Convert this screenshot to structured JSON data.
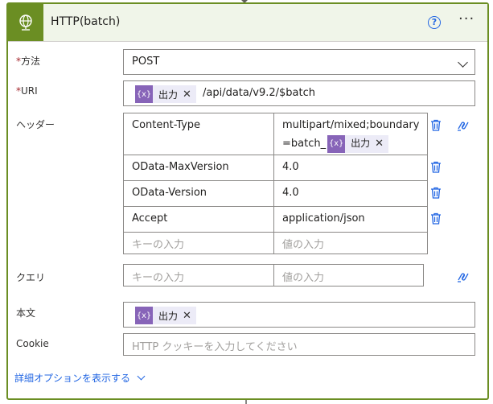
{
  "header": {
    "title": "HTTP(batch)",
    "help": "?",
    "more": "···"
  },
  "method": {
    "label": "方法",
    "required_mark": "*",
    "value": "POST"
  },
  "uri": {
    "label": "URI",
    "required_mark": "*",
    "token": {
      "icon": "{x}",
      "label": "出力"
    },
    "suffix": "/api/data/v9.2/$batch"
  },
  "headers": {
    "label": "ヘッダー",
    "rows": [
      {
        "key": "Content-Type",
        "value_line1": "multipart/mixed;boundary",
        "value_prefix": "=batch_",
        "token": {
          "icon": "{x}",
          "label": "出力"
        }
      },
      {
        "key": "OData-MaxVersion",
        "value": "4.0"
      },
      {
        "key": "OData-Version",
        "value": "4.0"
      },
      {
        "key": "Accept",
        "value": "application/json"
      }
    ],
    "key_placeholder": "キーの入力",
    "value_placeholder": "値の入力"
  },
  "query": {
    "label": "クエリ",
    "key_placeholder": "キーの入力",
    "value_placeholder": "値の入力"
  },
  "body": {
    "label": "本文",
    "token": {
      "icon": "{x}",
      "label": "出力"
    }
  },
  "cookie": {
    "label": "Cookie",
    "placeholder": "HTTP クッキーを入力してください"
  },
  "advanced": {
    "label": "詳細オプションを表示する"
  },
  "colors": {
    "accent": "#6b8e23",
    "token": "#8764b8",
    "link": "#2266e3"
  }
}
